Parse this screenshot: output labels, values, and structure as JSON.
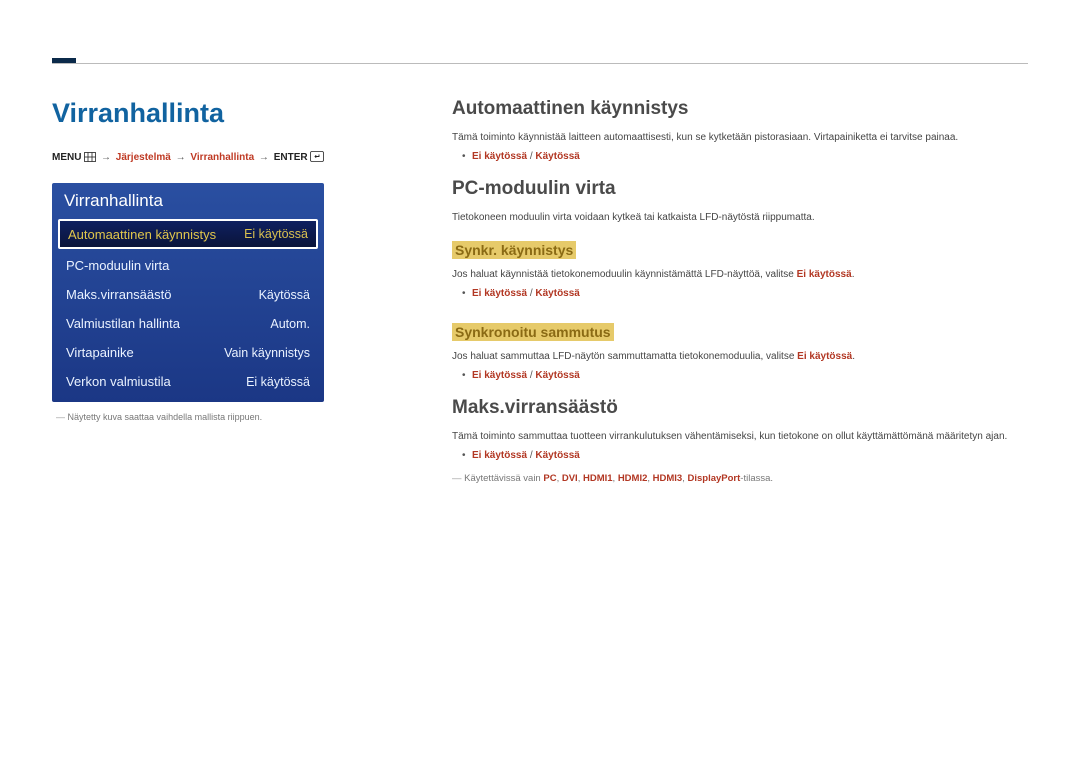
{
  "page_title": "Virranhallinta",
  "breadcrumb": {
    "menu_label": "MENU",
    "parts": [
      "Järjestelmä",
      "Virranhallinta"
    ],
    "enter_label": "ENTER"
  },
  "osd": {
    "title": "Virranhallinta",
    "rows": [
      {
        "label": "Automaattinen käynnistys",
        "value": "Ei käytössä",
        "selected": true
      },
      {
        "label": "PC-moduulin virta",
        "value": "",
        "selected": false
      },
      {
        "label": "Maks.virransäästö",
        "value": "Käytössä",
        "selected": false
      },
      {
        "label": "Valmiustilan hallinta",
        "value": "Autom.",
        "selected": false
      },
      {
        "label": "Virtapainike",
        "value": "Vain käynnistys",
        "selected": false
      },
      {
        "label": "Verkon valmiustila",
        "value": "Ei käytössä",
        "selected": false
      }
    ],
    "footnote": "Näytetty kuva saattaa vaihdella mallista riippuen."
  },
  "options": {
    "off_on_pair": {
      "off": "Ei käytössä",
      "on": "Käytössä"
    }
  },
  "sections": {
    "auto_on": {
      "title": "Automaattinen käynnistys",
      "body": "Tämä toiminto käynnistää laitteen automaattisesti, kun se kytketään pistorasiaan. Virtapainiketta ei tarvitse painaa."
    },
    "pc_module": {
      "title": "PC-moduulin virta",
      "body": "Tietokoneen moduulin virta voidaan kytkeä tai katkaista LFD-näytöstä riippumatta.",
      "sync_on": {
        "title": "Synkr. käynnistys",
        "body_pre": "Jos haluat käynnistää tietokonemoduulin käynnistämättä LFD-näyttöä, valitse ",
        "body_red": "Ei käytössä",
        "body_post": "."
      },
      "sync_off": {
        "title": "Synkronoitu sammutus",
        "body_pre": "Jos haluat sammuttaa LFD-näytön sammuttamatta tietokonemoduulia, valitse ",
        "body_red": "Ei käytössä",
        "body_post": "."
      }
    },
    "max_save": {
      "title": "Maks.virransäästö",
      "body": "Tämä toiminto sammuttaa tuotteen virrankulutuksen vähentämiseksi, kun tietokone on ollut käyttämättömänä määritetyn ajan.",
      "inputs": {
        "lead": "Käytettävissä vain ",
        "ports": [
          "PC",
          "DVI",
          "HDMI1",
          "HDMI2",
          "HDMI3",
          "DisplayPort"
        ],
        "suffix": "-tilassa."
      }
    }
  }
}
